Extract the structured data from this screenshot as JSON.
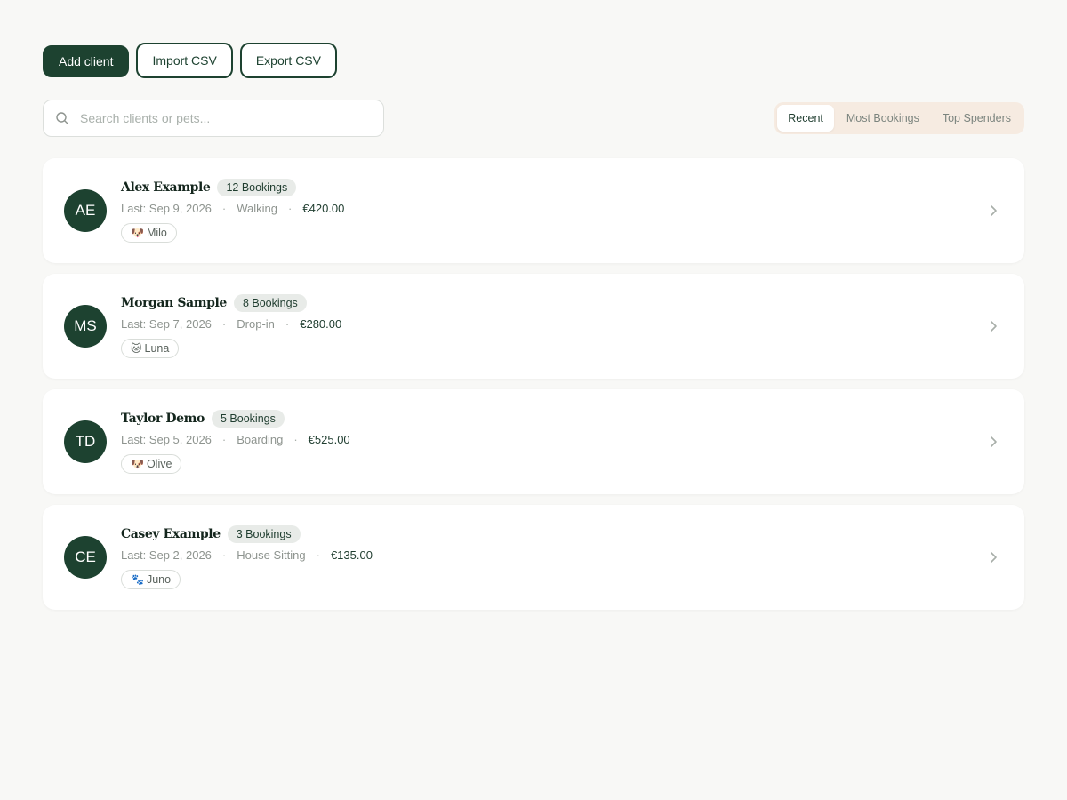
{
  "toolbar": {
    "add_label": "Add client",
    "import_label": "Import CSV",
    "export_label": "Export CSV"
  },
  "search": {
    "placeholder": "Search clients or pets...",
    "value": ""
  },
  "sort": {
    "tabs": [
      "Recent",
      "Most Bookings",
      "Top Spenders"
    ],
    "active": "Recent"
  },
  "clients": [
    {
      "initials": "AE",
      "name": "Alex Example",
      "bookings": "12 Bookings",
      "last": "Last: Sep 9, 2026",
      "service": "Walking",
      "amount": "€420.00",
      "pet_emoji": "🐶",
      "pet": "Milo"
    },
    {
      "initials": "MS",
      "name": "Morgan Sample",
      "bookings": "8 Bookings",
      "last": "Last: Sep 7, 2026",
      "service": "Drop-in",
      "amount": "€280.00",
      "pet_emoji": "🐱",
      "pet": "Luna"
    },
    {
      "initials": "TD",
      "name": "Taylor Demo",
      "bookings": "5 Bookings",
      "last": "Last: Sep 5, 2026",
      "service": "Boarding",
      "amount": "€525.00",
      "pet_emoji": "🐶",
      "pet": "Olive"
    },
    {
      "initials": "CE",
      "name": "Casey Example",
      "bookings": "3 Bookings",
      "last": "Last: Sep 2, 2026",
      "service": "House Sitting",
      "amount": "€135.00",
      "pet_emoji": "🐾",
      "pet": "Juno"
    }
  ],
  "meta_separator": "·",
  "colors": {
    "brand": "#1d4230",
    "background": "#f8f8f6",
    "sort_group_bg": "#f6ebe1"
  },
  "icons": {
    "search": "search-icon",
    "chevron": "chevron-right-icon"
  }
}
